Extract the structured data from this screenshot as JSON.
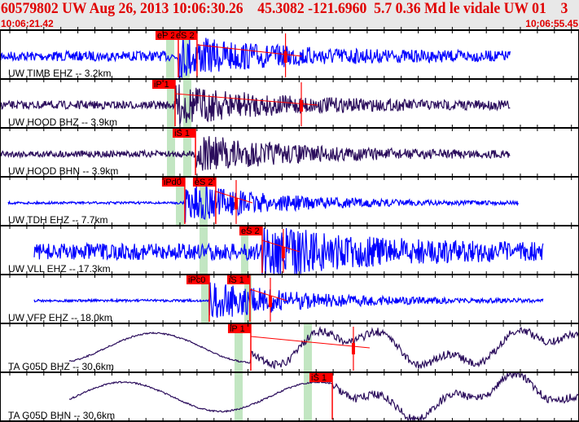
{
  "header": {
    "title": "60579802 UW Aug 26, 2013 10:06:30.26    45.3082 -121.6960  5.7 0.36 Md le vidale UW 01    3",
    "start_time": "10:06:21.42",
    "end_time": "10:06:55.45"
  },
  "colors": {
    "header_bg": "#e8e8e8",
    "header_text": "#e00000",
    "pick": "#ff0000",
    "window": "#c2e6c2",
    "trace_short": "#0000ff",
    "trace_broad": "#2b0d5c"
  },
  "channels": [
    {
      "label": "UW TIMB EHZ -- 3.2km",
      "color": "trace_short",
      "picks": [
        {
          "text": "eP 2",
          "time": "10:06:31.90"
        },
        {
          "text": "eS 2",
          "time": "10:06:33.00"
        }
      ],
      "coda": "10:06:38.20"
    },
    {
      "label": "UW HOOD BHZ -- 3.9km",
      "color": "trace_broad",
      "picks": [
        {
          "text": "iP 1",
          "time": "10:06:31.71"
        }
      ],
      "coda": "10:06:39.13"
    },
    {
      "label": "UW HOOD BHN -- 3.9km",
      "color": "trace_broad",
      "picks": [
        {
          "text": "iS 1",
          "time": "10:06:32.91"
        }
      ]
    },
    {
      "label": "UW TDH EHZ -- 7.7km",
      "color": "trace_short",
      "picks": [
        {
          "text": "iPd0",
          "time": "10:06:32.28"
        },
        {
          "text": "eS 2",
          "time": "10:06:34.10"
        }
      ],
      "coda": "10:06:35.30"
    },
    {
      "label": "UW VLL EHZ -- 17.3km",
      "color": "trace_short",
      "picks": [
        {
          "text": "eS 2",
          "time": "10:06:36.83"
        }
      ],
      "coda": "10:06:38.07"
    },
    {
      "label": "UW VFP EHZ -- 18.0km",
      "color": "trace_short",
      "picks": [
        {
          "text": "iPc0",
          "time": "10:06:33.72"
        },
        {
          "text": "iS 1",
          "time": "10:06:36.11"
        }
      ],
      "coda": "10:06:37.31"
    },
    {
      "label": "TA G05D BHZ -- 30.6km",
      "color": "trace_broad",
      "picks": [
        {
          "text": "iP 1",
          "time": "10:06:36.16"
        }
      ],
      "coda": "10:06:42.19"
    },
    {
      "label": "TA G05D BHN -- 30.6km",
      "color": "trace_broad",
      "picks": [
        {
          "text": "iS 1",
          "time": "10:06:40.95"
        }
      ]
    }
  ]
}
